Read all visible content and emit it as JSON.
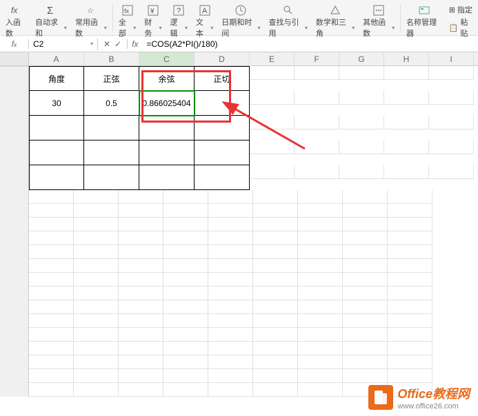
{
  "ribbon": {
    "insert_fn": "入函数",
    "autosum": "自动求和",
    "common_fn": "常用函数",
    "all": "全部",
    "financial": "财务",
    "logical": "逻辑",
    "text": "文本",
    "datetime": "日期和时间",
    "lookup": "查找与引用",
    "math_trig": "数学和三角",
    "other_fn": "其他函数",
    "name_mgr": "名称管理器",
    "specify": "指定",
    "paste": "粘贴"
  },
  "name_box": "C2",
  "fx_label": "fx",
  "formula": "=COS(A2*PI()/180)",
  "columns": [
    "A",
    "B",
    "C",
    "D",
    "E",
    "F",
    "G",
    "H",
    "I"
  ],
  "headers": {
    "col_a": "角度",
    "col_b": "正弦",
    "col_c": "余弦",
    "col_d": "正切"
  },
  "data": {
    "a2": "30",
    "b2": "0.5",
    "c2": "0.866025404"
  },
  "watermark": {
    "title": "Office教程网",
    "url": "www.office26.com"
  },
  "chart_data": {
    "type": "table",
    "columns": [
      "角度",
      "正弦",
      "余弦",
      "正切"
    ],
    "rows": [
      [
        30,
        0.5,
        0.866025404,
        null
      ]
    ]
  }
}
